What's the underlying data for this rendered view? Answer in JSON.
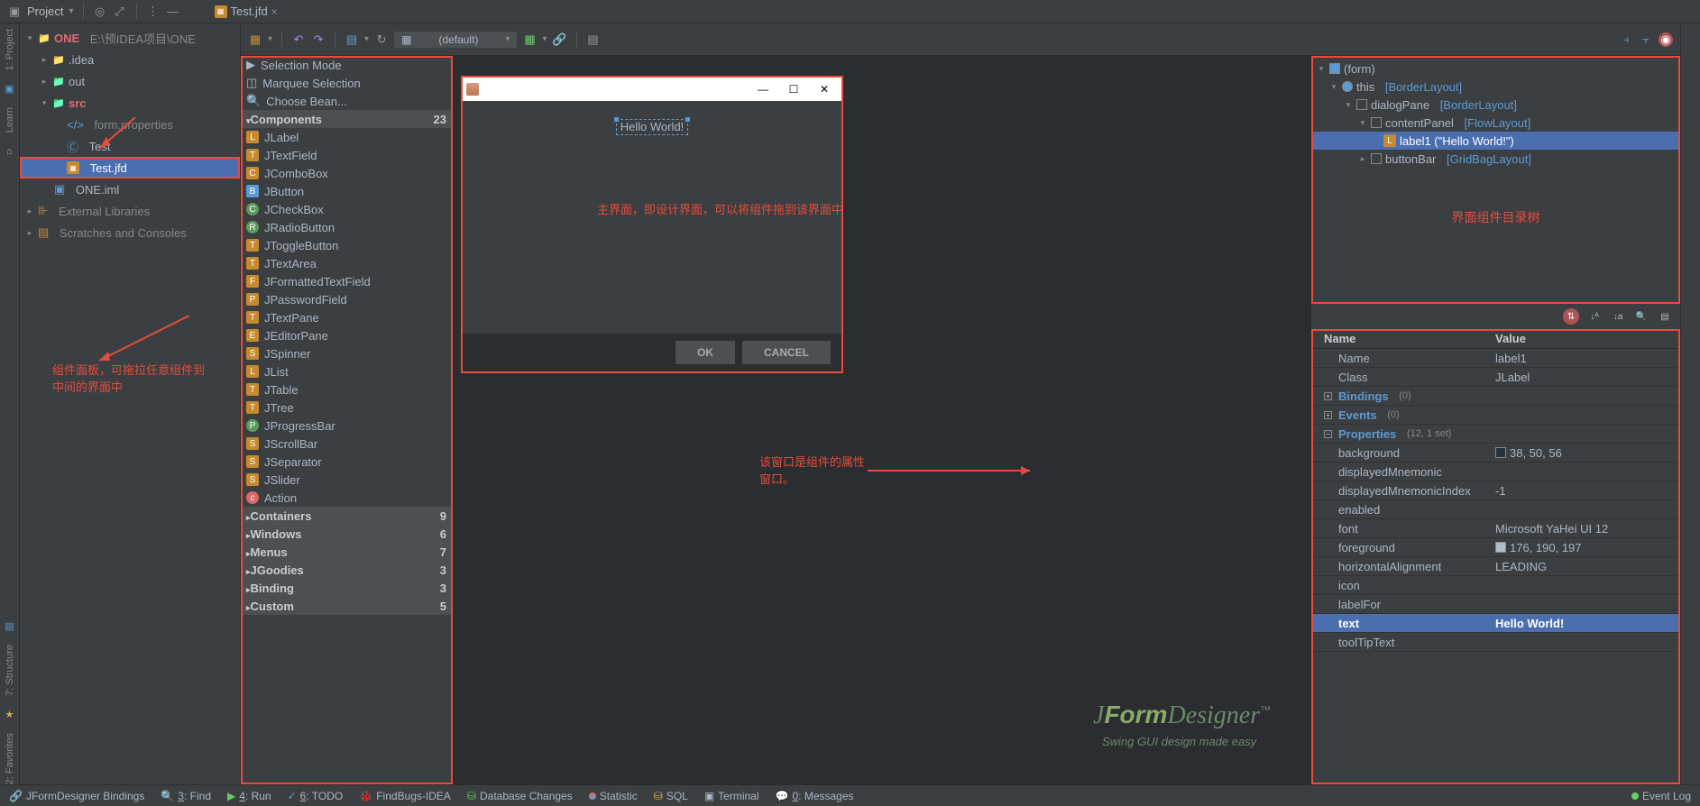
{
  "titlebar": {
    "project_label": "Project",
    "tab_name": "Test.jfd"
  },
  "project_tree": {
    "root": {
      "name": "ONE",
      "path": "E:\\预IDEA项目\\ONE"
    },
    "idea": ".idea",
    "out": "out",
    "src": "src",
    "form_props": "form.properties",
    "test": "Test",
    "test_jfd": "Test.jfd",
    "one_iml": "ONE.iml",
    "ext_libs": "External Libraries",
    "scratches": "Scratches and Consoles"
  },
  "editor_tab": "Test.jfd",
  "toolbar": {
    "default": "(default)"
  },
  "palette": {
    "sel_mode": "Selection Mode",
    "marquee": "Marquee Selection",
    "choose_bean": "Choose Bean...",
    "components_header": "Components",
    "components_count": "23",
    "components": [
      "JLabel",
      "JTextField",
      "JComboBox",
      "JButton",
      "JCheckBox",
      "JRadioButton",
      "JToggleButton",
      "JTextArea",
      "JFormattedTextField",
      "JPasswordField",
      "JTextPane",
      "JEditorPane",
      "JSpinner",
      "JList",
      "JTable",
      "JTree",
      "JProgressBar",
      "JScrollBar",
      "JSeparator",
      "JSlider",
      "Action"
    ],
    "containers": "Containers",
    "containers_n": "9",
    "windows": "Windows",
    "windows_n": "6",
    "menus": "Menus",
    "menus_n": "7",
    "jgoodies": "JGoodies",
    "jgoodies_n": "3",
    "binding": "Binding",
    "binding_n": "3",
    "custom": "Custom",
    "custom_n": "5"
  },
  "canvas": {
    "hello": "Hello World!",
    "ok": "OK",
    "cancel": "CANCEL",
    "anno1": "主界面，即设计界面，可以将组件拖到该界面中",
    "anno2": "该窗口是组件的属性窗口。",
    "anno_palette": "组件面板，可拖拉任意组件到中间的界面中"
  },
  "structure": {
    "form": "(form)",
    "this": "this",
    "this_lay": "[BorderLayout]",
    "dialogPane": "dialogPane",
    "dialogPane_lay": "[BorderLayout]",
    "contentPanel": "contentPanel",
    "contentPanel_lay": "[FlowLayout]",
    "label1": "label1 (\"Hello World!\")",
    "buttonBar": "buttonBar",
    "buttonBar_lay": "[GridBagLayout]",
    "anno": "界面组件目录树"
  },
  "props": {
    "name_h": "Name",
    "value_h": "Value",
    "Name": "Name",
    "Name_v": "label1",
    "Class": "Class",
    "Class_v": "JLabel",
    "Bindings": "Bindings",
    "Bindings_n": "(0)",
    "Events": "Events",
    "Events_n": "(0)",
    "Properties": "Properties",
    "Properties_n": "(12, 1 set)",
    "background": "background",
    "background_v": "38, 50, 56",
    "displayedMnemonic": "displayedMnemonic",
    "displayedMnemonicIndex": "displayedMnemonicIndex",
    "dmi_v": "-1",
    "enabled": "enabled",
    "font": "font",
    "font_v": "Microsoft YaHei UI 12",
    "foreground": "foreground",
    "foreground_v": "176, 190, 197",
    "horizontalAlignment": "horizontalAlignment",
    "ha_v": "LEADING",
    "icon": "icon",
    "labelFor": "labelFor",
    "text": "text",
    "text_v": "Hello World!",
    "toolTipText": "toolTipText"
  },
  "status": {
    "bindings": "JFormDesigner Bindings",
    "find": "3: Find",
    "run": "4: Run",
    "todo": "6: TODO",
    "findbugs": "FindBugs-IDEA",
    "db": "Database Changes",
    "stat": "Statistic",
    "sql": "SQL",
    "term": "Terminal",
    "msgs": "0: Messages",
    "evlog": "Event Log"
  },
  "logo": {
    "main": "JFormDesigner",
    "sub": "Swing GUI design made easy"
  }
}
